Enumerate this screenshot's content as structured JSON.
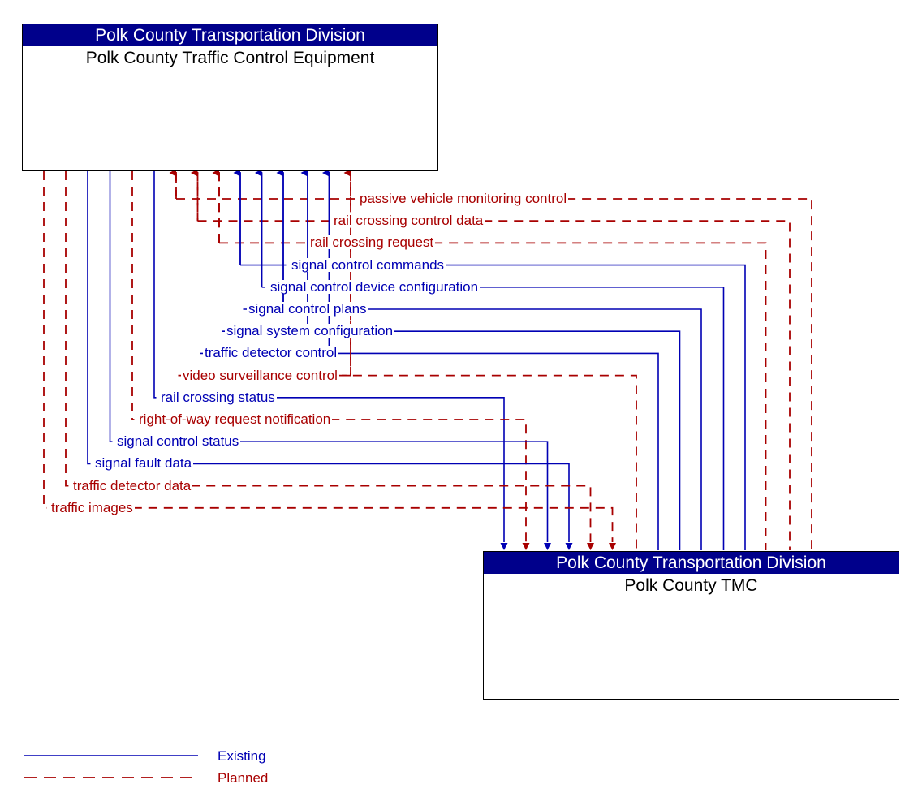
{
  "diagram": {
    "title": "Polk County Traffic Control Equipment / Polk County TMC interconnect",
    "colors": {
      "existing": "#0000b4",
      "planned": "#a80000",
      "header_bg": "#00008b",
      "header_text": "#ffffff",
      "box_border": "#000000",
      "background": "#ffffff"
    }
  },
  "nodes": [
    {
      "id": "traffic-control-equipment",
      "stakeholder": "Polk County Transportation Division",
      "name": "Polk County Traffic Control Equipment"
    },
    {
      "id": "tmc",
      "stakeholder": "Polk County Transportation Division",
      "name": "Polk County TMC"
    }
  ],
  "flows": [
    {
      "label": "passive vehicle monitoring control",
      "status": "planned",
      "direction": "tmc-to-equipment"
    },
    {
      "label": "rail crossing control data",
      "status": "planned",
      "direction": "tmc-to-equipment"
    },
    {
      "label": "rail crossing request",
      "status": "planned",
      "direction": "tmc-to-equipment"
    },
    {
      "label": "signal control commands",
      "status": "existing",
      "direction": "tmc-to-equipment"
    },
    {
      "label": "signal control device configuration",
      "status": "existing",
      "direction": "tmc-to-equipment"
    },
    {
      "label": "signal control plans",
      "status": "existing",
      "direction": "tmc-to-equipment"
    },
    {
      "label": "signal system configuration",
      "status": "existing",
      "direction": "tmc-to-equipment"
    },
    {
      "label": "traffic detector control",
      "status": "existing",
      "direction": "tmc-to-equipment"
    },
    {
      "label": "video surveillance control",
      "status": "planned",
      "direction": "tmc-to-equipment"
    },
    {
      "label": "rail crossing status",
      "status": "existing",
      "direction": "equipment-to-tmc"
    },
    {
      "label": "right-of-way request notification",
      "status": "planned",
      "direction": "equipment-to-tmc"
    },
    {
      "label": "signal control status",
      "status": "existing",
      "direction": "equipment-to-tmc"
    },
    {
      "label": "signal fault data",
      "status": "existing",
      "direction": "equipment-to-tmc"
    },
    {
      "label": "traffic detector data",
      "status": "planned",
      "direction": "equipment-to-tmc"
    },
    {
      "label": "traffic images",
      "status": "planned",
      "direction": "equipment-to-tmc"
    }
  ],
  "legend": {
    "existing_label": "Existing",
    "planned_label": "Planned"
  }
}
